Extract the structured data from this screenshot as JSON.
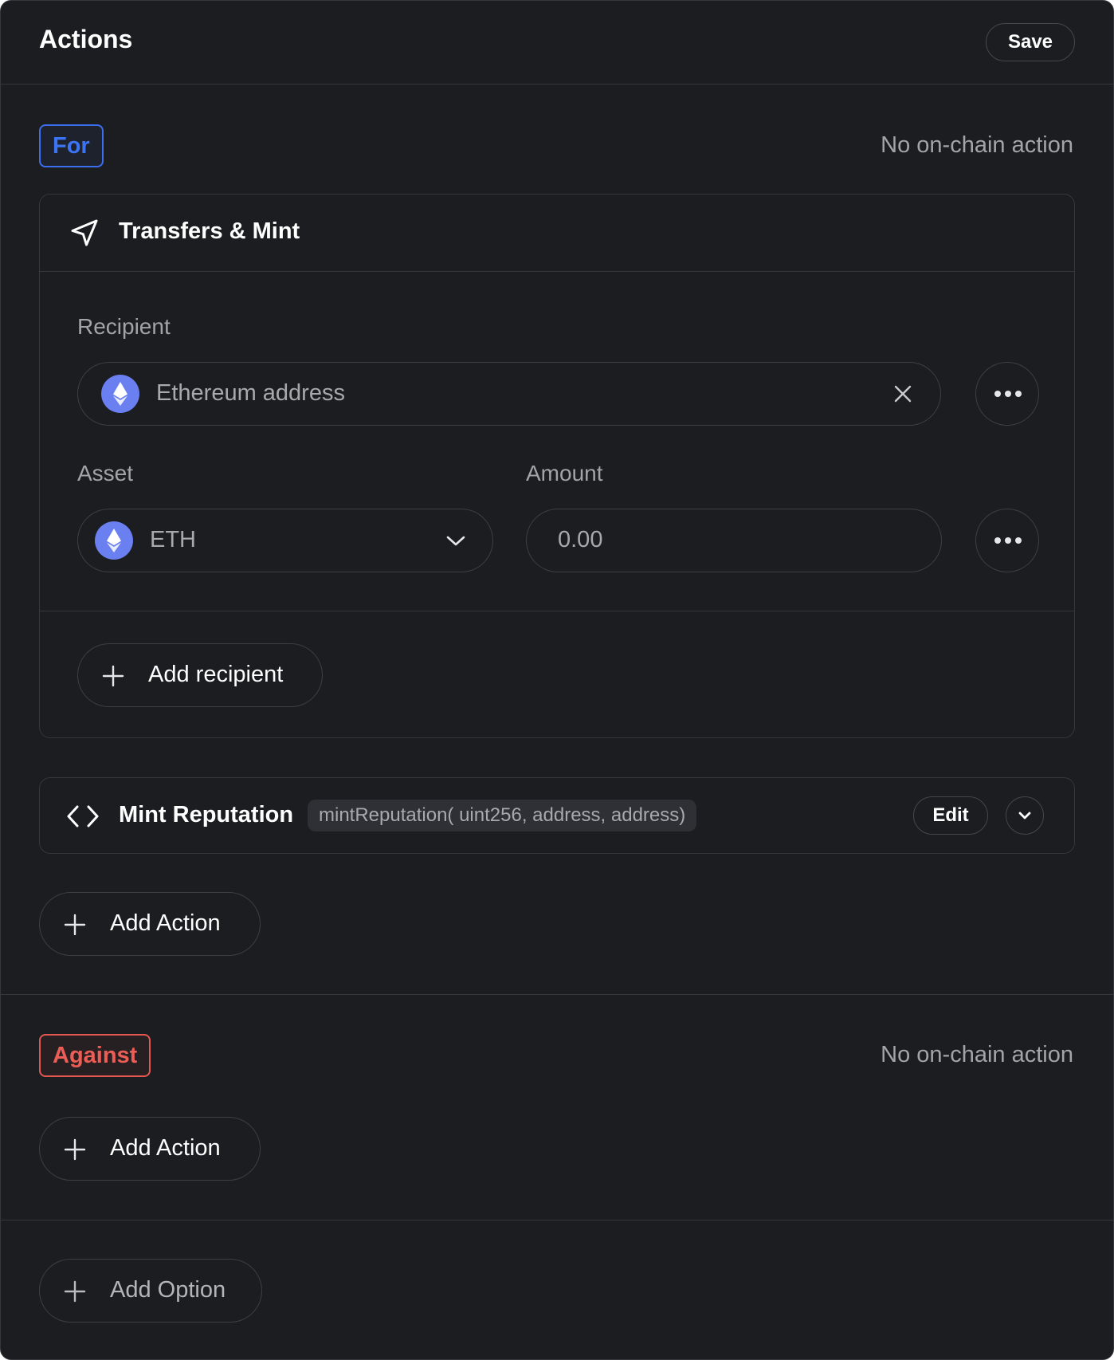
{
  "header": {
    "title": "Actions",
    "save_label": "Save"
  },
  "for_section": {
    "badge": "For",
    "status": "No on-chain action",
    "transfers_card": {
      "title": "Transfers & Mint",
      "icon": "send-icon",
      "recipient": {
        "label": "Recipient",
        "placeholder": "Ethereum address",
        "icon": "ethereum-icon",
        "clear_icon": "close-icon",
        "more_icon": "more-horizontal-icon"
      },
      "asset": {
        "label": "Asset",
        "selected": "ETH",
        "icon": "ethereum-icon",
        "dropdown_icon": "chevron-down-icon"
      },
      "amount": {
        "label": "Amount",
        "placeholder": "0.00",
        "more_icon": "more-horizontal-icon"
      },
      "add_recipient_label": "Add recipient"
    },
    "mint_card": {
      "title": "Mint Reputation",
      "icon": "code-icon",
      "signature": "mintReputation( uint256, address, address)",
      "edit_label": "Edit",
      "expand_icon": "chevron-down-icon"
    },
    "add_action_label": "Add Action"
  },
  "against_section": {
    "badge": "Against",
    "status": "No on-chain action",
    "add_action_label": "Add Action"
  },
  "add_option_label": "Add Option",
  "colors": {
    "background": "#1c1d20",
    "border": "#35373c",
    "for_accent": "#3b6ff0",
    "against_accent": "#e2574f",
    "ethereum": "#6a7ff0",
    "muted_text": "#a2a4a9"
  }
}
